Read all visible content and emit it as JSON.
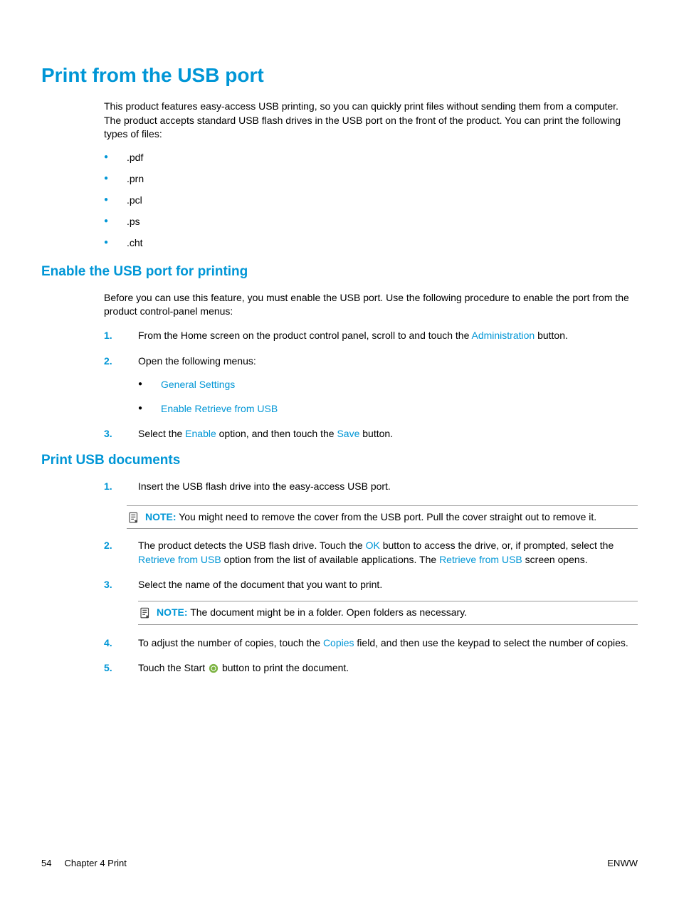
{
  "page": {
    "title": "Print from the USB port",
    "intro": "This product features easy-access USB printing, so you can quickly print files without sending them from a computer. The product accepts standard USB flash drives in the USB port on the front of the product. You can print the following types of files:",
    "file_types": [
      ".pdf",
      ".prn",
      ".pcl",
      ".ps",
      ".cht"
    ]
  },
  "section1": {
    "heading": "Enable the USB port for printing",
    "intro": "Before you can use this feature, you must enable the USB port. Use the following procedure to enable the port from the product control-panel menus:",
    "steps": [
      {
        "num": "1.",
        "text_before": "From the Home screen on the product control panel, scroll to and touch the ",
        "link": "Administration",
        "text_after": " button."
      },
      {
        "num": "2.",
        "text": "Open the following menus:",
        "bullets": [
          "General Settings",
          "Enable Retrieve from USB"
        ]
      },
      {
        "num": "3.",
        "text_before": "Select the ",
        "link1": "Enable",
        "text_mid": " option, and then touch the ",
        "link2": "Save",
        "text_after": " button."
      }
    ]
  },
  "section2": {
    "heading": "Print USB documents",
    "step1": {
      "num": "1.",
      "text": "Insert the USB flash drive into the easy-access USB port."
    },
    "note1": {
      "label": "NOTE:",
      "text": "You might need to remove the cover from the USB port. Pull the cover straight out to remove it."
    },
    "step2": {
      "num": "2.",
      "text_before": "The product detects the USB flash drive. Touch the ",
      "link1": "OK",
      "text_mid1": " button to access the drive, or, if prompted, select the ",
      "link2": "Retrieve from USB",
      "text_mid2": " option from the list of available applications. The ",
      "link3": "Retrieve from USB",
      "text_after": " screen opens."
    },
    "step3": {
      "num": "3.",
      "text": "Select the name of the document that you want to print."
    },
    "note2": {
      "label": "NOTE:",
      "text": "The document might be in a folder. Open folders as necessary."
    },
    "step4": {
      "num": "4.",
      "text_before": "To adjust the number of copies, touch the ",
      "link": "Copies",
      "text_after": " field, and then use the keypad to select the number of copies."
    },
    "step5": {
      "num": "5.",
      "text_before": "Touch the Start ",
      "text_after": " button to print the document."
    }
  },
  "footer": {
    "page_num": "54",
    "chapter": "Chapter 4   Print",
    "right": "ENWW"
  }
}
